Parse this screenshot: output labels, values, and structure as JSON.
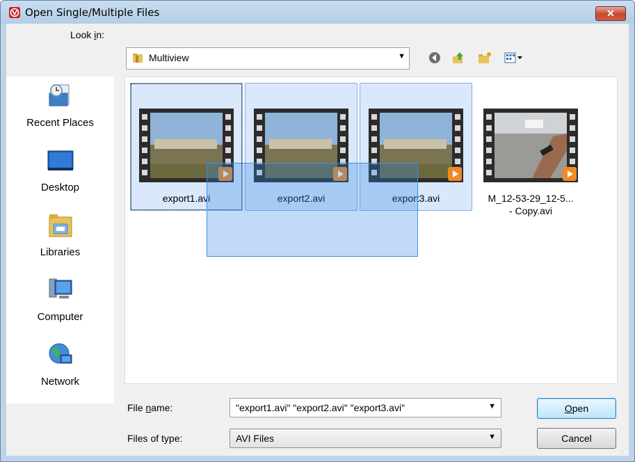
{
  "window": {
    "title": "Open Single/Multiple Files",
    "close_glyph": "✕"
  },
  "look_in": {
    "label_prefix": "Look ",
    "label_accel": "i",
    "label_suffix": "n:",
    "value": "Multiview",
    "toolbar_icons": [
      "back-icon",
      "up-folder-icon",
      "new-folder-icon",
      "view-menu-icon"
    ]
  },
  "places": [
    {
      "label": "Recent Places",
      "icon": "recent-places-icon"
    },
    {
      "label": "Desktop",
      "icon": "desktop-icon"
    },
    {
      "label": "Libraries",
      "icon": "libraries-icon"
    },
    {
      "label": "Computer",
      "icon": "computer-icon"
    },
    {
      "label": "Network",
      "icon": "network-icon"
    }
  ],
  "files": [
    {
      "name": "export1.avi",
      "selected": true,
      "focused": true
    },
    {
      "name": "export2.avi",
      "selected": true,
      "focused": false
    },
    {
      "name": "export3.avi",
      "selected": true,
      "focused": false
    },
    {
      "name_line1": "M_12-53-29_12-5...",
      "name_line2": "- Copy.avi",
      "selected": false,
      "focused": false
    }
  ],
  "file_name": {
    "label_prefix": "File ",
    "label_accel": "n",
    "label_suffix": "ame:",
    "value": "\"export1.avi\" \"export2.avi\" \"export3.avi\""
  },
  "file_type": {
    "label": "Files of type:",
    "value": "AVI Files"
  },
  "buttons": {
    "open_accel": "O",
    "open_rest": "pen",
    "cancel": "Cancel"
  },
  "colors": {
    "selection": "#d9e8fb",
    "marquee": "#3a8ee6",
    "app_icon": "#c8231e"
  }
}
